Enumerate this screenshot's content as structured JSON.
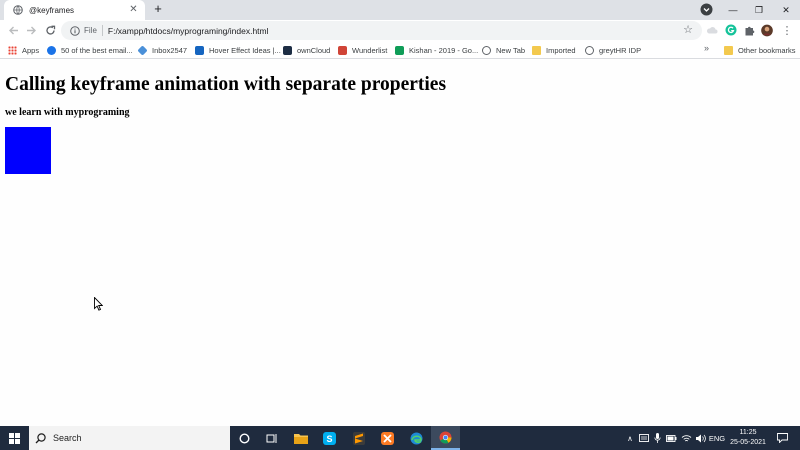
{
  "tab": {
    "title": "@keyframes",
    "favicon": "globe-icon"
  },
  "toolbar": {
    "file_label": "File",
    "url": "F:/xampp/htdocs/myprograming/index.html"
  },
  "bookmarks": [
    {
      "label": "Apps",
      "icon": "apps-grid-icon",
      "color": "#ea4335"
    },
    {
      "label": "50 of the best email...",
      "icon": "c-circle-icon",
      "color": "#1a73e8"
    },
    {
      "label": "Inbox2547",
      "icon": "mail-icon",
      "color": "#4a90d9"
    },
    {
      "label": "Hover Effect Ideas |...",
      "icon": "bookmark-icon",
      "color": "#1565c0"
    },
    {
      "label": "ownCloud",
      "icon": "cloud-icon",
      "color": "#1d2d44"
    },
    {
      "label": "Wunderlist",
      "icon": "star-box-icon",
      "color": "#d04437"
    },
    {
      "label": "Kishan - 2019 - Go...",
      "icon": "sheets-icon",
      "color": "#0f9d58"
    },
    {
      "label": "New Tab",
      "icon": "globe-icon",
      "color": "#5f6368"
    },
    {
      "label": "Imported",
      "icon": "folder-icon",
      "color": "#f3c94e"
    },
    {
      "label": "greytHR IDP",
      "icon": "globe-icon",
      "color": "#5f6368"
    }
  ],
  "other_bookmarks": "Other bookmarks",
  "page": {
    "heading": "Calling keyframe animation with separate properties",
    "subheading": "we learn with myprograming",
    "box_color": "#0000ff"
  },
  "taskbar": {
    "search_text": "Search",
    "language": "ENG",
    "time": "11:25",
    "date": "25-05-2021"
  }
}
